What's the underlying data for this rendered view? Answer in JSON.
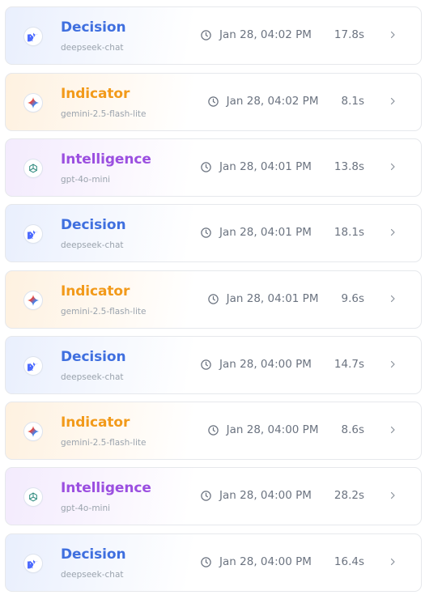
{
  "colors": {
    "decision": "#3f6fdf",
    "indicator": "#f29a1a",
    "intelligence": "#9b4fe0",
    "muted_text": "#9aa3ad"
  },
  "rows": [
    {
      "kind": "decision",
      "title": "Decision",
      "model": "deepseek-chat",
      "timestamp": "Jan 28, 04:02 PM",
      "duration": "17.8s",
      "icon": "deepseek-whale-icon"
    },
    {
      "kind": "indicator",
      "title": "Indicator",
      "model": "gemini-2.5-flash-lite",
      "timestamp": "Jan 28, 04:02 PM",
      "duration": "8.1s",
      "icon": "gemini-sparkle-icon"
    },
    {
      "kind": "intelligence",
      "title": "Intelligence",
      "model": "gpt-4o-mini",
      "timestamp": "Jan 28, 04:01 PM",
      "duration": "13.8s",
      "icon": "openai-logo-icon"
    },
    {
      "kind": "decision",
      "title": "Decision",
      "model": "deepseek-chat",
      "timestamp": "Jan 28, 04:01 PM",
      "duration": "18.1s",
      "icon": "deepseek-whale-icon"
    },
    {
      "kind": "indicator",
      "title": "Indicator",
      "model": "gemini-2.5-flash-lite",
      "timestamp": "Jan 28, 04:01 PM",
      "duration": "9.6s",
      "icon": "gemini-sparkle-icon"
    },
    {
      "kind": "decision",
      "title": "Decision",
      "model": "deepseek-chat",
      "timestamp": "Jan 28, 04:00 PM",
      "duration": "14.7s",
      "icon": "deepseek-whale-icon"
    },
    {
      "kind": "indicator",
      "title": "Indicator",
      "model": "gemini-2.5-flash-lite",
      "timestamp": "Jan 28, 04:00 PM",
      "duration": "8.6s",
      "icon": "gemini-sparkle-icon"
    },
    {
      "kind": "intelligence",
      "title": "Intelligence",
      "model": "gpt-4o-mini",
      "timestamp": "Jan 28, 04:00 PM",
      "duration": "28.2s",
      "icon": "openai-logo-icon"
    },
    {
      "kind": "decision",
      "title": "Decision",
      "model": "deepseek-chat",
      "timestamp": "Jan 28, 04:00 PM",
      "duration": "16.4s",
      "icon": "deepseek-whale-icon"
    }
  ]
}
